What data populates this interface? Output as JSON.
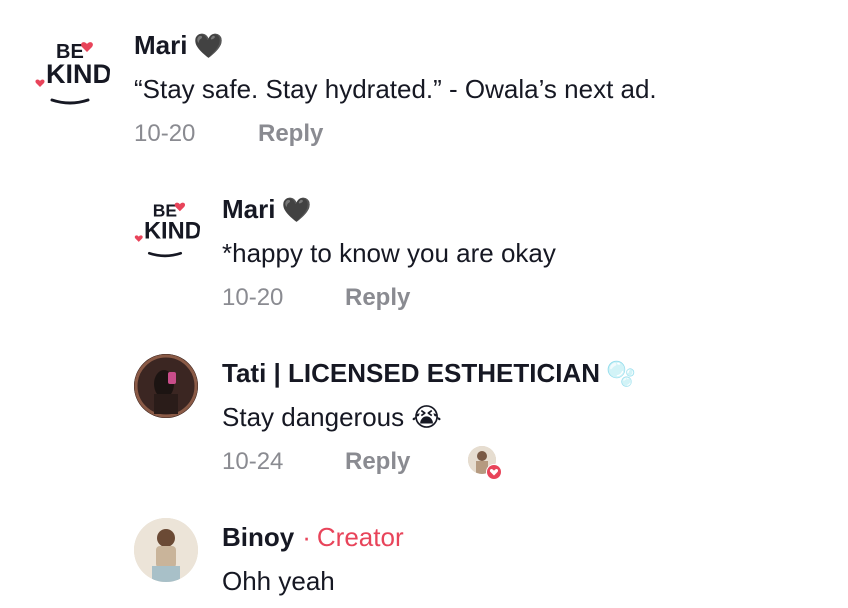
{
  "comments": [
    {
      "username": "Mari",
      "username_emoji": "🖤",
      "text": "“Stay safe. Stay hydrated.” - Owala’s next ad.",
      "date": "10-20",
      "reply_label": "Reply",
      "avatar": "be-kind-logo"
    },
    {
      "username": "Mari",
      "username_emoji": "🖤",
      "text": "*happy to know you are okay",
      "date": "10-20",
      "reply_label": "Reply",
      "avatar": "be-kind-logo"
    },
    {
      "username": "Tati | LICENSED ESTHETICIAN",
      "username_emoji": "🫧",
      "text": "Stay dangerous 😭",
      "date": "10-24",
      "reply_label": "Reply",
      "avatar": "photo-avatar",
      "liked_by_creator": true
    },
    {
      "username": "Binoy",
      "separator": "·",
      "badge": "Creator",
      "text": "Ohh yeah",
      "avatar": "photo-avatar"
    }
  ],
  "logo": {
    "line1": "BE",
    "line2": "KIND"
  },
  "colors": {
    "accent": "#e8445a",
    "meta": "#8a8b91",
    "text": "#161823"
  }
}
